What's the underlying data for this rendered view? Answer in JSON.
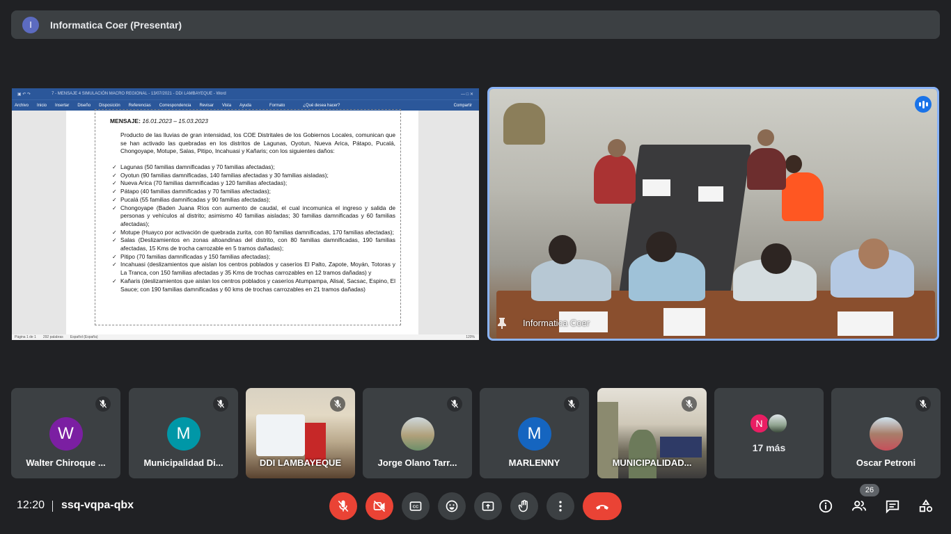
{
  "presenter_bar": {
    "avatar_letter": "I",
    "avatar_color": "#5c6bc0",
    "title": "Informatica Coer (Presentar)"
  },
  "document": {
    "window_title": "7 - MENSAJE 4 SIMULACIÓN MACRO REGIONAL - 13/07/2021 - DDI LAMBAYEQUE - Word",
    "ribbon_tabs": [
      "Archivo",
      "Inicio",
      "Insertar",
      "Diseño",
      "Disposición",
      "Referencias",
      "Correspondencia",
      "Revisar",
      "Vista",
      "Ayuda",
      "Formato",
      "¿Qué desea hacer?",
      "Compartir"
    ],
    "message_label": "MENSAJE:",
    "message_dates": "16.01.2023 – 15.03.2023",
    "intro": "Producto de las lluvias de gran intensidad, los COE Distritales de los Gobiernos Locales, comunican que se han activado las quebradas en los distritos de Lagunas, Oyotun, Nueva Arica, Pátapo, Pucalá, Chongoyape, Motupe, Salas, Pitipo, Incahuasi y Kañaris; con los siguientes daños:",
    "bullets": [
      "Lagunas (50 familias damnificadas y 70 familias afectadas);",
      "Oyotun (90 familias damnificadas, 140 familias afectadas y 30 familias aisladas);",
      "Nueva Arica (70 familias damnificadas y 120 familias afectadas);",
      "Pátapo (40 familias damnificadas y 70 familias afectadas);",
      "Pucalá (55 familias damnificadas y 90 familias afectadas);",
      "Chongoyape (Baden Juana Ríos con aumento de caudal, el cual incomunica el ingreso y salida de personas y vehículos al distrito; asimismo 40 familias aisladas; 30 familias damnificadas y 60 familias afectadas);",
      "Motupe (Huayco por activación de quebrada zurita, con 80 familias damnificadas, 170 familias afectadas);",
      "Salas (Deslizamientos en zonas altoandinas del distrito, con 80 familias damnificadas, 190 familias afectadas, 15 Kms de trocha carrozable en 5 tramos dañadas);",
      "Pitipo (70 familias damnificadas y 150 familias afectadas);",
      "Incahuasi (deslizamientos que aislan los centros poblados y caseríos El Palto, Zapote, Moyán, Totoras y La Tranca, con 150 familias afectadas y 35 Kms de trochas carrozables en 12 tramos dañadas) y",
      "Kañaris (deslizamientos que aislan los centros poblados y caseríos Atumpampa, Alisal, Sacsac, Espino, El Sauce; con 190 familias damnificadas y 60 kms de trochas carrozables en 21 tramos dañadas)"
    ],
    "status_left": "Página 1 de 1",
    "status_words": "292 palabras",
    "status_lang": "Español (España)",
    "status_zoom": "120%"
  },
  "camera": {
    "name": "Informatica Coer",
    "speaking_color": "#1a73e8",
    "border_color": "#8ab4f8"
  },
  "participants": [
    {
      "name": "Walter Chiroque ...",
      "letter": "W",
      "color": "#7b1fa2"
    },
    {
      "name": "Municipalidad Di...",
      "letter": "M",
      "color": "#0097a7"
    },
    {
      "name": "DDI LAMBAYEQUE",
      "letter": "",
      "color": ""
    },
    {
      "name": "Jorge Olano Tarr...",
      "letter": "",
      "color": ""
    },
    {
      "name": "MARLENNY",
      "letter": "M",
      "color": "#1565c0"
    },
    {
      "name": "MUNICIPALIDAD...",
      "letter": "",
      "color": ""
    },
    {
      "name": "Oscar Petroni",
      "letter": "",
      "color": ""
    }
  ],
  "more": {
    "label": "17 más",
    "letter": "N",
    "color": "#e91e63"
  },
  "bottom": {
    "time": "12:20",
    "meeting_code": "ssq-vqpa-qbx",
    "participants_count": "26"
  },
  "colors": {
    "background": "#202124",
    "tile": "#3c4043",
    "danger": "#ea4335"
  }
}
